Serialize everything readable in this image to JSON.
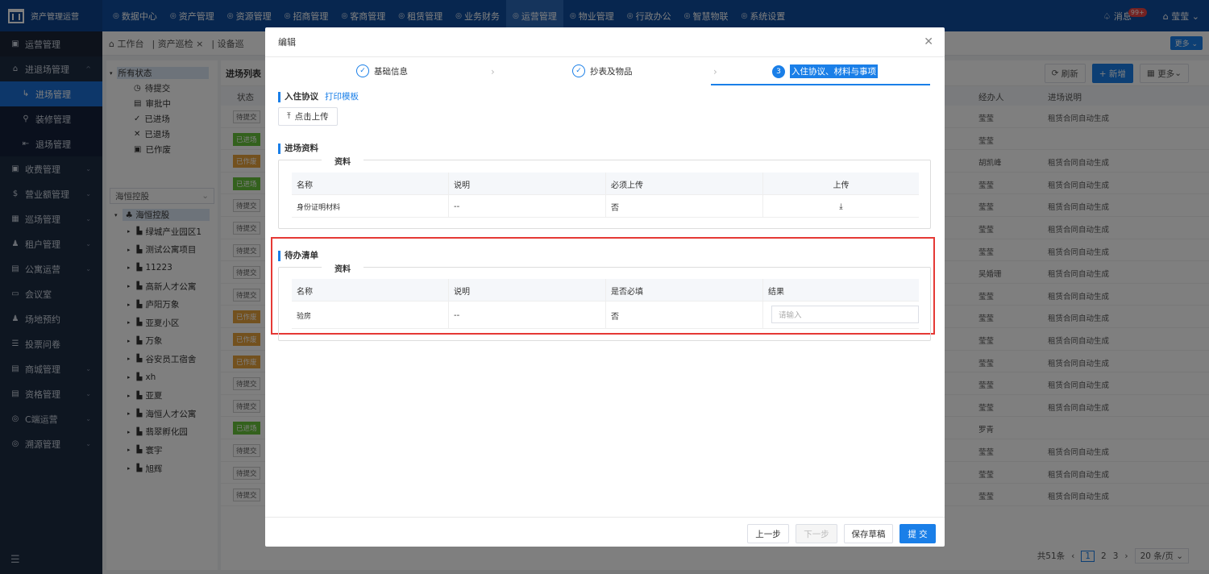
{
  "app": {
    "title": "资产管理运营"
  },
  "topnav": [
    {
      "label": "数据中心",
      "icon": "dashboard-icon"
    },
    {
      "label": "资产管理",
      "icon": "asset-icon"
    },
    {
      "label": "资源管理",
      "icon": "resource-icon"
    },
    {
      "label": "招商管理",
      "icon": "investment-icon"
    },
    {
      "label": "客商管理",
      "icon": "customer-icon"
    },
    {
      "label": "租赁管理",
      "icon": "lease-icon"
    },
    {
      "label": "业务财务",
      "icon": "finance-icon"
    },
    {
      "label": "运营管理",
      "icon": "operation-icon",
      "active": true
    },
    {
      "label": "物业管理",
      "icon": "property-icon"
    },
    {
      "label": "行政办公",
      "icon": "office-icon"
    },
    {
      "label": "智慧物联",
      "icon": "iot-icon"
    },
    {
      "label": "系统设置",
      "icon": "settings-icon"
    }
  ],
  "topright": {
    "messages": "消息",
    "badge": "99+",
    "user": "莹莹"
  },
  "sidebar": [
    {
      "label": "运营管理",
      "type": "header"
    },
    {
      "label": "进退场管理",
      "type": "group",
      "expanded": true
    },
    {
      "label": "进场管理",
      "type": "sub",
      "active": true
    },
    {
      "label": "装修管理",
      "type": "sub"
    },
    {
      "label": "退场管理",
      "type": "sub"
    },
    {
      "label": "收费管理",
      "type": "group"
    },
    {
      "label": "营业额管理",
      "type": "group"
    },
    {
      "label": "巡场管理",
      "type": "group"
    },
    {
      "label": "租户管理",
      "type": "group"
    },
    {
      "label": "公寓运营",
      "type": "group"
    },
    {
      "label": "会议室",
      "type": "item"
    },
    {
      "label": "场地预约",
      "type": "item"
    },
    {
      "label": "投票问卷",
      "type": "item"
    },
    {
      "label": "商城管理",
      "type": "group"
    },
    {
      "label": "资格管理",
      "type": "group"
    },
    {
      "label": "C端运营",
      "type": "group"
    },
    {
      "label": "溯源管理",
      "type": "group"
    }
  ],
  "tabs": [
    "工作台",
    "资产巡检",
    "设备巡"
  ],
  "tabs_more": "更多",
  "statusTree": {
    "root": "所有状态",
    "items": [
      "待提交",
      "审批中",
      "已进场",
      "已退场",
      "已作废"
    ]
  },
  "orgSelect": "海恒控股",
  "orgTree": {
    "root": "海恒控股",
    "items": [
      "绿城产业园区1",
      "测试公寓项目",
      "11223",
      "高新人才公寓",
      "庐阳万象",
      "亚夏小区",
      "万象",
      "谷安员工宿舍",
      "xh",
      "亚夏",
      "海恒人才公寓",
      "翡翠孵化园",
      "寰宇",
      "旭辉"
    ]
  },
  "list": {
    "title": "进场列表",
    "buttons": {
      "refresh": "刷新",
      "add": "+ 新增",
      "more": "更多"
    },
    "columns": {
      "status": "状态",
      "handler": "经办人",
      "desc": "进场说明"
    },
    "rows": [
      {
        "status": "待提交",
        "handler": "莹莹",
        "desc": "租赁合同自动生成"
      },
      {
        "status": "已进场",
        "handler": "莹莹",
        "desc": ""
      },
      {
        "status": "已作废",
        "handler": "胡凯峰",
        "desc": "租赁合同自动生成"
      },
      {
        "status": "已进场",
        "handler": "莹莹",
        "desc": "租赁合同自动生成"
      },
      {
        "status": "待提交",
        "handler": "莹莹",
        "desc": "租赁合同自动生成"
      },
      {
        "status": "待提交",
        "handler": "莹莹",
        "desc": "租赁合同自动生成"
      },
      {
        "status": "待提交",
        "handler": "莹莹",
        "desc": "租赁合同自动生成"
      },
      {
        "status": "待提交",
        "handler": "吴婚珊",
        "desc": "租赁合同自动生成"
      },
      {
        "status": "待提交",
        "handler": "莹莹",
        "desc": "租赁合同自动生成"
      },
      {
        "status": "已作废",
        "handler": "莹莹",
        "desc": "租赁合同自动生成"
      },
      {
        "status": "已作废",
        "handler": "莹莹",
        "desc": "租赁合同自动生成"
      },
      {
        "status": "已作废",
        "handler": "莹莹",
        "desc": "租赁合同自动生成"
      },
      {
        "status": "待提交",
        "handler": "莹莹",
        "desc": "租赁合同自动生成"
      },
      {
        "status": "待提交",
        "handler": "莹莹",
        "desc": "租赁合同自动生成"
      },
      {
        "status": "已进场",
        "handler": "罗青",
        "desc": ""
      },
      {
        "status": "待提交",
        "handler": "莹莹",
        "desc": "租赁合同自动生成"
      },
      {
        "status": "待提交",
        "handler": "莹莹",
        "desc": "租赁合同自动生成"
      },
      {
        "status": "待提交",
        "handler": "莹莹",
        "desc": "租赁合同自动生成"
      }
    ],
    "pager": {
      "total": "共51条",
      "pages": [
        "1",
        "2",
        "3"
      ],
      "size": "20 条/页"
    }
  },
  "modal": {
    "title": "编辑",
    "steps": [
      {
        "label": "基础信息"
      },
      {
        "label": "抄表及物品"
      },
      {
        "num": "3",
        "label": "入住协议、材料与事项"
      }
    ],
    "agreement": {
      "title": "入住协议",
      "link": "打印模板",
      "upload": "点击上传"
    },
    "materials": {
      "title": "进场资料",
      "legend": "资料",
      "headers": [
        "名称",
        "说明",
        "必须上传",
        "上传"
      ],
      "row": [
        "身份证明材料",
        "--",
        "否"
      ]
    },
    "todo": {
      "title": "待办清单",
      "legend": "资料",
      "headers": [
        "名称",
        "说明",
        "是否必填",
        "结果"
      ],
      "row": [
        "验房",
        "--",
        "否"
      ],
      "placeholder": "请输入"
    },
    "footer": {
      "prev": "上一步",
      "next": "下一步",
      "draft": "保存草稿",
      "submit": "提 交"
    }
  }
}
